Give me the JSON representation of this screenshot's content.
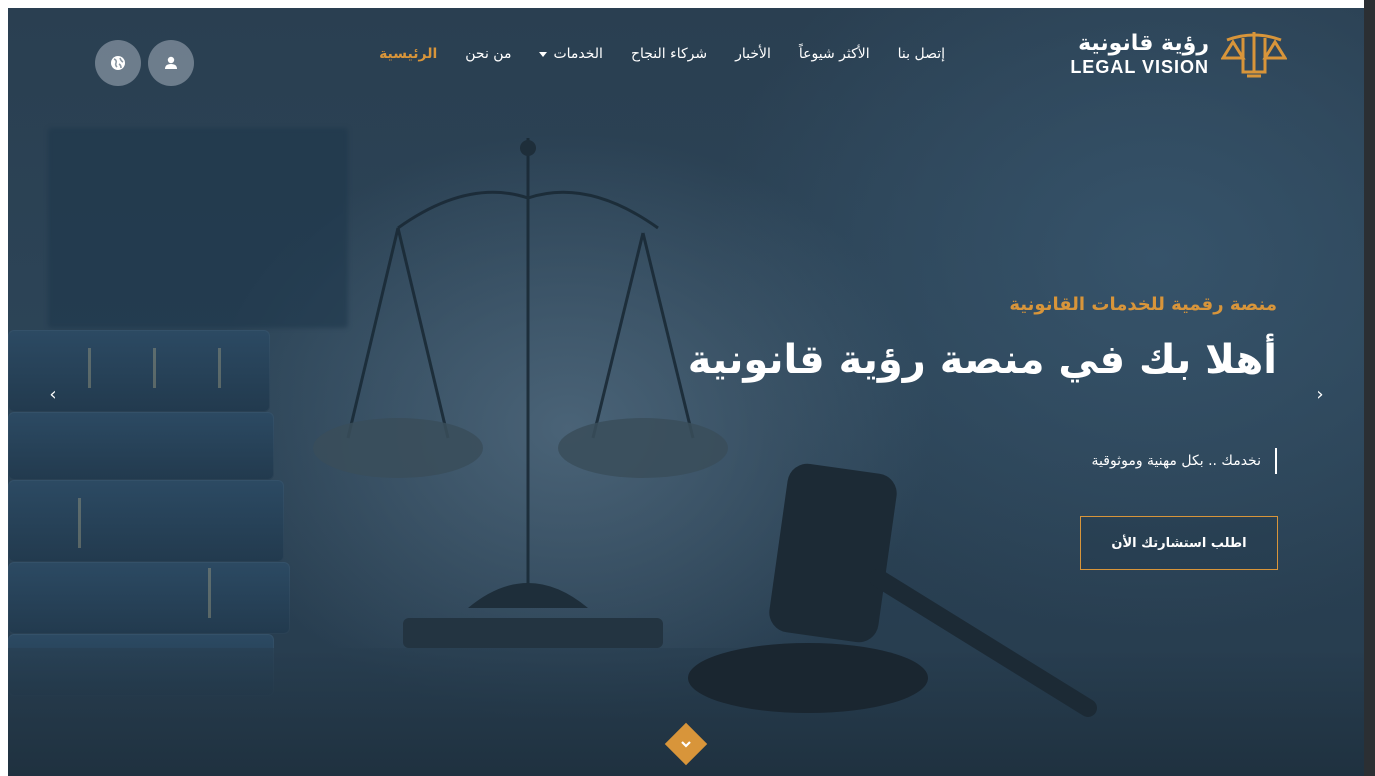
{
  "logo": {
    "arabic": "رؤية قانونية",
    "english": "LEGAL VISION",
    "icon": "scales-logo-icon"
  },
  "nav": {
    "items": [
      {
        "label": "الرئيسية",
        "active": true
      },
      {
        "label": "من نحن",
        "active": false
      },
      {
        "label": "الخدمات",
        "active": false,
        "dropdown": true
      },
      {
        "label": "شركاء النجاح",
        "active": false
      },
      {
        "label": "الأخبار",
        "active": false
      },
      {
        "label": "الأكثر شيوعاً",
        "active": false
      },
      {
        "label": "إتصل بنا",
        "active": false
      }
    ]
  },
  "header_icons": {
    "user": "user-icon",
    "language": "globe-icon"
  },
  "hero": {
    "subtitle": "منصة رقمية للخدمات القانونية",
    "title": "أهلا بك في منصة رؤية قانونية",
    "tagline": "نخدمك .. بكل مهنية وموثوقية",
    "cta_label": "اطلب استشارتك الأن"
  },
  "slider": {
    "prev_icon": "chevron-left-icon",
    "next_icon": "chevron-right-icon",
    "prev_glyph": "‹",
    "next_glyph": "›"
  },
  "colors": {
    "accent": "#d8953a",
    "overlay": "#2c4457",
    "text": "#ffffff"
  }
}
